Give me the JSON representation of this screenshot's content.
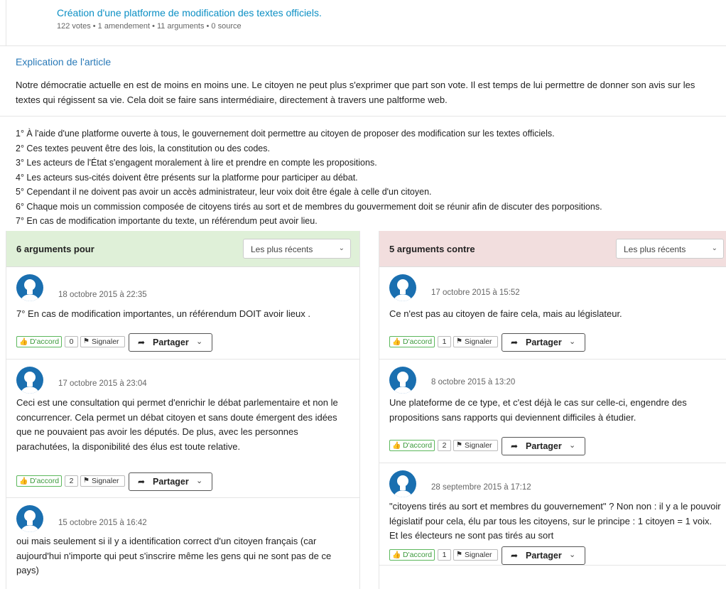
{
  "opinion": {
    "title": "Création d'une platforme de modification des textes officiels.",
    "meta": "122 votes • 1 amendement • 11 arguments • 0 source"
  },
  "explanation": {
    "heading": "Explication de l'article",
    "text": "Notre démocratie actuelle en est de moins en moins une. Le citoyen ne peut plus s'exprimer que part son vote. Il est temps de lui permettre de donner son avis sur les textes qui régissent sa vie. Cela doit se faire sans intermédiaire, directement à travers une paltforme web."
  },
  "points": [
    "1° À l'aide d'une platforme ouverte à tous, le gouvernement doit permettre au citoyen de proposer des modification sur les textes officiels.",
    "2° Ces textes peuvent être des lois, la constitution ou des codes.",
    "3° Les acteurs de l'État s'engagent moralement à lire et prendre en compte les propositions.",
    "4° Les acteurs sus-cités doivent être présents sur la platforme pour participer au débat.",
    "5° Cependant il ne doivent pas avoir un accès administrateur, leur voix doit être égale à celle d'un citoyen.",
    "6° Chaque mois un commission composée de citoyens tirés au sort et de membres du gouvermement doit se réunir afin de discuter des porpositions.",
    "7° En cas de modification importante du texte, un référendum peut avoir lieu."
  ],
  "labels": {
    "agree": "D'accord",
    "report": "Signaler",
    "share": "Partager",
    "sort": "Les plus récents"
  },
  "colors": {
    "pour_bg": "#dff0d8",
    "contre_bg": "#f2dede",
    "link": "#0b8fc4",
    "agree": "#5cb85c"
  },
  "pour": {
    "header": "6 arguments pour",
    "arguments": [
      {
        "date": "18 octobre 2015 à 22:35",
        "text": "7° En cas de modification importantes, un référendum DOIT avoir lieux .",
        "votes": "0"
      },
      {
        "date": "17 octobre 2015 à 23:04",
        "text": "Ceci est une consultation qui permet d'enrichir le débat parlementaire et non le concurrencer. Cela permet un débat citoyen et sans doute émergent des idées que ne pouvaient pas avoir les députés. De plus, avec les personnes parachutées, la disponibilité des élus est toute relative.",
        "votes": "2"
      },
      {
        "date": "15 octobre 2015 à 16:42",
        "text": "oui mais seulement si il y a identification correct d'un citoyen français (car aujourd'hui n'importe qui peut s'inscrire même les gens qui ne sont pas de ce pays)",
        "votes": ""
      }
    ]
  },
  "contre": {
    "header": "5 arguments contre",
    "arguments": [
      {
        "date": "17 octobre 2015 à 15:52",
        "text": "Ce n'est pas au citoyen de faire cela, mais au législateur.",
        "votes": "1"
      },
      {
        "date": "8 octobre 2015 à 13:20",
        "text": "Une plateforme de ce type, et c'est déjà le cas sur celle-ci, engendre des propositions sans rapports qui deviennent difficiles à étudier.",
        "votes": "2"
      },
      {
        "date": "28 septembre 2015 à 17:12",
        "text": "\"citoyens tirés au sort et membres du gouvernement\" ? Non non : il y a le pouvoir législatif pour cela, élu par tous les citoyens, sur le principe : 1 citoyen = 1 voix. Et les électeurs ne sont pas tirés au sort",
        "votes": "1"
      }
    ]
  }
}
